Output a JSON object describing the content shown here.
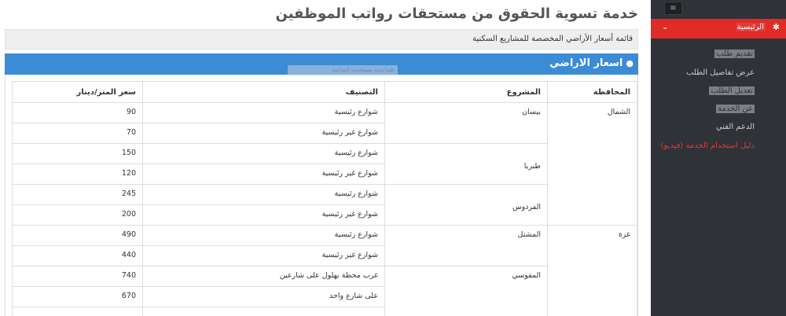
{
  "header": {
    "title": "خدمة تسوية الحقوق من مستحقات رواتب الموظفين",
    "subtitle": "قائمة أسعار الأراضي المخصصة للمشاريع السكنية"
  },
  "panel": {
    "title": "اسعار الاراضي",
    "overlay_text": "تصاعدية مستخدمة الشاشة",
    "overlay_close": "×"
  },
  "table": {
    "headers": [
      "المحافظة",
      "المشروع",
      "التصنيف",
      "سعر المتر/دينار"
    ],
    "governorates": [
      {
        "name": "الشمال",
        "projects": [
          {
            "name": "بيسان",
            "rows": [
              {
                "class": "شوارع رئيسية",
                "price": "90"
              },
              {
                "class": "شوارع غير رئيسية",
                "price": "70"
              }
            ]
          },
          {
            "name": "طبريا",
            "rows": [
              {
                "class": "شوارع رئيسية",
                "price": "150"
              },
              {
                "class": "شوارع غير رئيسية",
                "price": "120"
              }
            ]
          },
          {
            "name": "الفردوس",
            "rows": [
              {
                "class": "شوارع رئيسية",
                "price": "245"
              },
              {
                "class": "شوارع غير رئيسية",
                "price": "200"
              }
            ]
          }
        ]
      },
      {
        "name": "غزة",
        "projects": [
          {
            "name": "المشتل",
            "rows": [
              {
                "class": "شوارع رئيسية",
                "price": "490"
              },
              {
                "class": "شوارع غير رئيسية",
                "price": "440"
              }
            ]
          },
          {
            "name": "المقوسي",
            "rows": [
              {
                "class": "غرب محطة بهلول على شارعين",
                "price": "740"
              },
              {
                "class": "على شارع واحد",
                "price": "670"
              }
            ]
          }
        ]
      }
    ]
  },
  "sidebar": {
    "toggle_icon": "menu-icon",
    "home": {
      "label": "الرئيسية",
      "icon": "gears-icon"
    },
    "items": [
      {
        "label": "تقديم طلب",
        "highlight": true
      },
      {
        "label": "عرض تفاصيل الطلب",
        "highlight": false
      },
      {
        "label": "تعديل الطلب",
        "highlight": true
      },
      {
        "label": "عن الخدمة",
        "highlight": true
      },
      {
        "label": "الدعم الفني",
        "highlight": false
      },
      {
        "label": "دليل استخدام الخدمة (فيديو)",
        "highlight": false,
        "red": true
      }
    ],
    "accent": "#e02b27",
    "bg": "#2f3237"
  },
  "colors": {
    "panel_blue": "#3b8bd6",
    "link_red": "#e03a34"
  }
}
